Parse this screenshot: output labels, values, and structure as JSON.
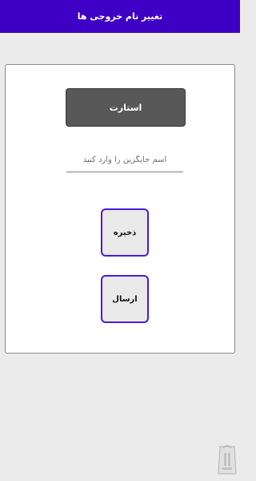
{
  "app_bar": {
    "title": "تغییر نام خروجی ها",
    "color": "#3d00c4"
  },
  "card": {
    "start_button": "استارت",
    "name_input": {
      "placeholder": "اسم جایگزین را وارد کنید",
      "value": ""
    },
    "save_button": "ذخیره",
    "send_button": "ارسال"
  },
  "colors": {
    "accent": "#4b1bd1",
    "start_bg": "#585858",
    "page_bg": "#ebebeb"
  },
  "icons": {
    "corner_logo": "bazaar-bag-icon"
  }
}
